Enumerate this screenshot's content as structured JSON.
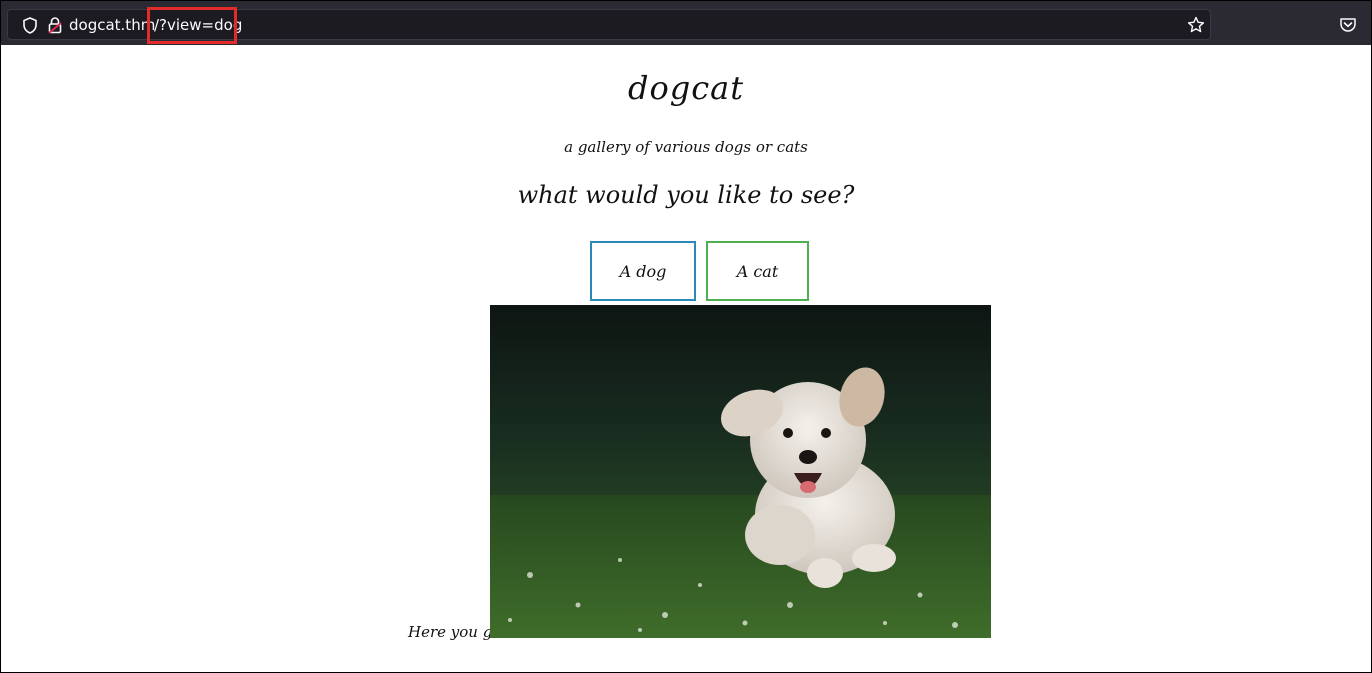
{
  "browser": {
    "url_host": "dogcat.thm",
    "url_path": "/?view=dog"
  },
  "page": {
    "title": "dogcat",
    "subtitle": "a gallery of various dogs or cats",
    "question": "what would you like to see?",
    "buttons": {
      "dog": "A dog",
      "cat": "A cat"
    },
    "caption": "Here you go!"
  },
  "colors": {
    "dog_button_border": "#2a89b9",
    "cat_button_border": "#4caf50",
    "highlight": "#e32b2b"
  },
  "icons": [
    "shield-icon",
    "lock-icon",
    "star-icon",
    "pocket-icon"
  ]
}
